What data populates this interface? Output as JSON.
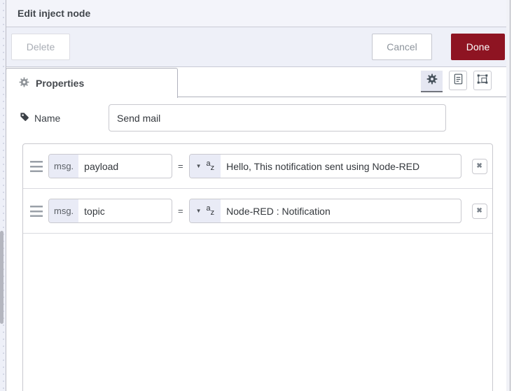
{
  "window": {
    "title": "Edit inject node"
  },
  "toolbar": {
    "delete_label": "Delete",
    "cancel_label": "Cancel",
    "done_label": "Done"
  },
  "tab": {
    "label": "Properties"
  },
  "name_field": {
    "label": "Name",
    "value": "Send mail"
  },
  "rules": [
    {
      "prefix": "msg.",
      "property": "payload",
      "operator": "=",
      "value": "Hello, This notification sent using Node-RED"
    },
    {
      "prefix": "msg.",
      "property": "topic",
      "operator": "=",
      "value": "Node-RED : Notification"
    }
  ],
  "icons": {
    "caret": "▼",
    "close": "✖",
    "az_sup": "a",
    "az_sub": "z",
    "gear": "gear",
    "document": "document",
    "appearance": "node-appearance",
    "tag": "tag",
    "drag_handle": "drag-handle"
  },
  "colors": {
    "accent_red": "#8e1422",
    "toolbar_bg": "#eef0f8",
    "header_bg": "#f3f4fa",
    "typed_input_prefix_bg": "#e9ebf6",
    "border": "#c9c9cf"
  }
}
